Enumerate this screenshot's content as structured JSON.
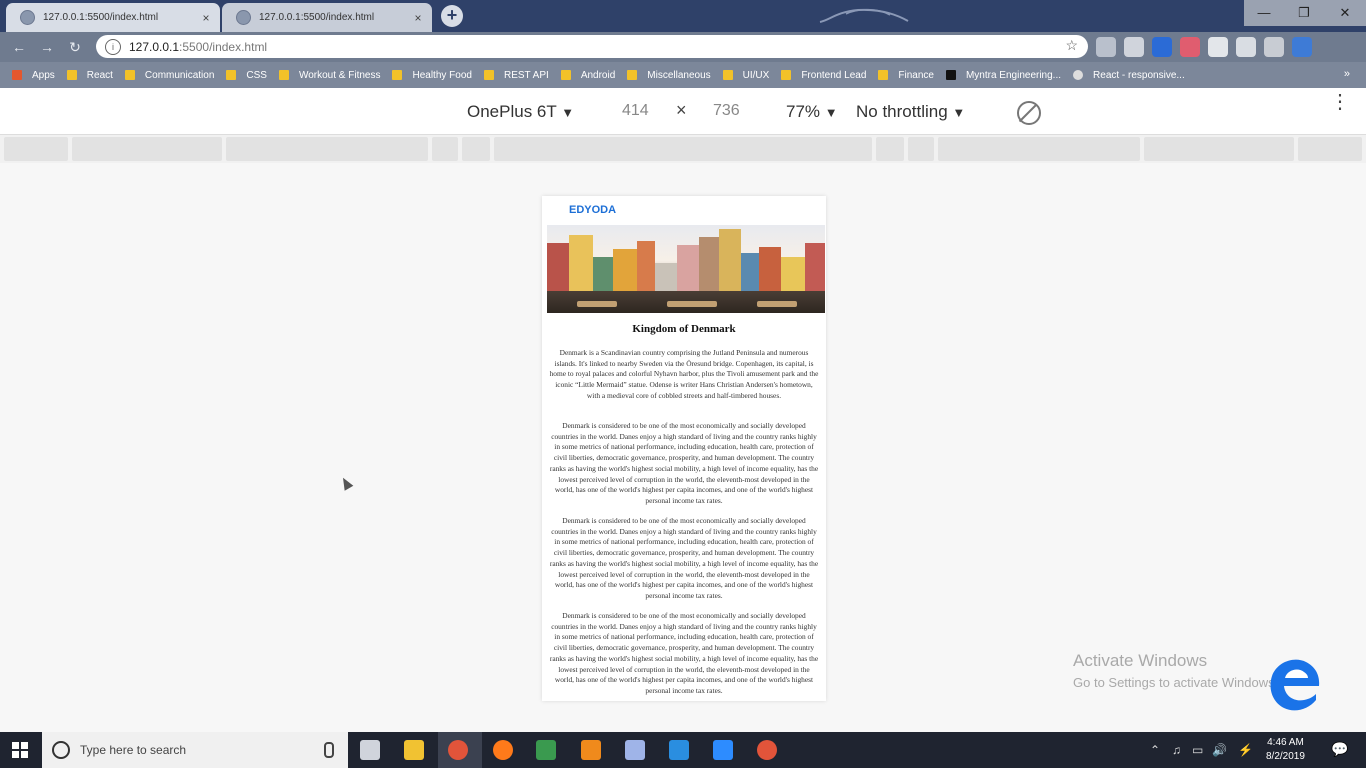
{
  "browser": {
    "tabs": [
      {
        "title": "127.0.0.1:5500/index.html",
        "close": "×"
      },
      {
        "title": "127.0.0.1:5500/index.html",
        "close": "×"
      }
    ],
    "new_tab": "+",
    "window_controls": {
      "minimize": "—",
      "maximize": "❐",
      "close": "✕"
    },
    "nav": {
      "back": "←",
      "forward": "→",
      "reload": "↻"
    },
    "address": {
      "info": "i",
      "host": "127.0.0.1",
      "rest": ":5500/index.html",
      "star": "☆"
    },
    "extensions": [
      "#b9c0cc",
      "#d0d4dc",
      "#2b6bd6",
      "#e05d6f",
      "#e3e6ea",
      "#d9dde3",
      "#c8ccd3",
      "#3e7bd6"
    ],
    "bookmarks": [
      {
        "label": "Apps",
        "icon": "apps-grid-icon"
      },
      {
        "label": "React",
        "icon": "folder-icon"
      },
      {
        "label": "Communication",
        "icon": "folder-icon"
      },
      {
        "label": "CSS",
        "icon": "folder-icon"
      },
      {
        "label": "Workout & Fitness",
        "icon": "folder-icon"
      },
      {
        "label": "Healthy Food",
        "icon": "folder-icon"
      },
      {
        "label": "REST API",
        "icon": "folder-icon"
      },
      {
        "label": "Android",
        "icon": "folder-icon"
      },
      {
        "label": "Miscellaneous",
        "icon": "folder-icon"
      },
      {
        "label": "UI/UX",
        "icon": "folder-icon"
      },
      {
        "label": "Frontend Lead",
        "icon": "folder-icon"
      },
      {
        "label": "Finance",
        "icon": "folder-icon"
      },
      {
        "label": "Myntra Engineering...",
        "icon": "medium-logo-icon"
      },
      {
        "label": "React - responsive...",
        "icon": "globe-icon"
      }
    ],
    "bookmarks_more": "»"
  },
  "devtools": {
    "device": "OnePlus 6T",
    "width": "414",
    "times": "×",
    "height": "736",
    "zoom": "77%",
    "throttling": "No throttling",
    "dropdown_arrow": "▼",
    "more": "⋮"
  },
  "site": {
    "brand": "EDYODA",
    "heading": "Kingdom of Denmark",
    "paragraphs": [
      "Denmark is a Scandinavian country comprising the Jutland Peninsula and numerous islands. It's linked to nearby Sweden via the Öresund bridge. Copenhagen, its capital, is home to royal palaces and colorful Nyhavn harbor, plus the Tivoli amusement park and the iconic “Little Mermaid” statue. Odense is writer Hans Christian Andersen's hometown, with a medieval core of cobbled streets and half-timbered houses.",
      "Denmark is considered to be one of the most economically and socially developed countries in the world. Danes enjoy a high standard of living and the country ranks highly in some metrics of national performance, including education, health care, protection of civil liberties, democratic governance, prosperity, and human development. The country ranks as having the world's highest social mobility, a high level of income equality, has the lowest perceived level of corruption in the world, the eleventh-most developed in the world, has one of the world's highest per capita incomes, and one of the world's highest personal income tax rates.",
      "Denmark is considered to be one of the most economically and socially developed countries in the world. Danes enjoy a high standard of living and the country ranks highly in some metrics of national performance, including education, health care, protection of civil liberties, democratic governance, prosperity, and human development. The country ranks as having the world's highest social mobility, a high level of income equality, has the lowest perceived level of corruption in the world, the eleventh-most developed in the world, has one of the world's highest per capita incomes, and one of the world's highest personal income tax rates.",
      "Denmark is considered to be one of the most economically and socially developed countries in the world. Danes enjoy a high standard of living and the country ranks highly in some metrics of national performance, including education, health care, protection of civil liberties, democratic governance, prosperity, and human development. The country ranks as having the world's highest social mobility, a high level of income equality, has the lowest perceived level of corruption in the world, the eleventh-most developed in the world, has one of the world's highest per capita incomes, and one of the world's highest personal income tax rates."
    ]
  },
  "watermark": {
    "title": "Activate Windows",
    "subtitle": "Go to Settings to activate Windows."
  },
  "taskbar": {
    "search_placeholder": "Type here to search",
    "apps": [
      {
        "name": "task-view-icon",
        "color": "#d0d4dc"
      },
      {
        "name": "file-explorer-icon",
        "color": "#f1c232"
      },
      {
        "name": "chrome-icon",
        "color": "#e2543a"
      },
      {
        "name": "firefox-icon",
        "color": "#ff7a1a"
      },
      {
        "name": "spreadsheet-app-icon",
        "color": "#3a9a4f"
      },
      {
        "name": "vlc-icon",
        "color": "#f08a1c"
      },
      {
        "name": "network-tool-icon",
        "color": "#9fb4e8"
      },
      {
        "name": "vscode-icon",
        "color": "#2a8ee0"
      },
      {
        "name": "zoom-icon",
        "color": "#2d8cff"
      },
      {
        "name": "chrome-alt-icon",
        "color": "#e2543a"
      }
    ],
    "tray": [
      "⌃",
      "♫",
      "▭",
      "🔊",
      "⚡"
    ],
    "time": "4:46 AM",
    "date": "8/2/2019",
    "notification": "💬"
  }
}
